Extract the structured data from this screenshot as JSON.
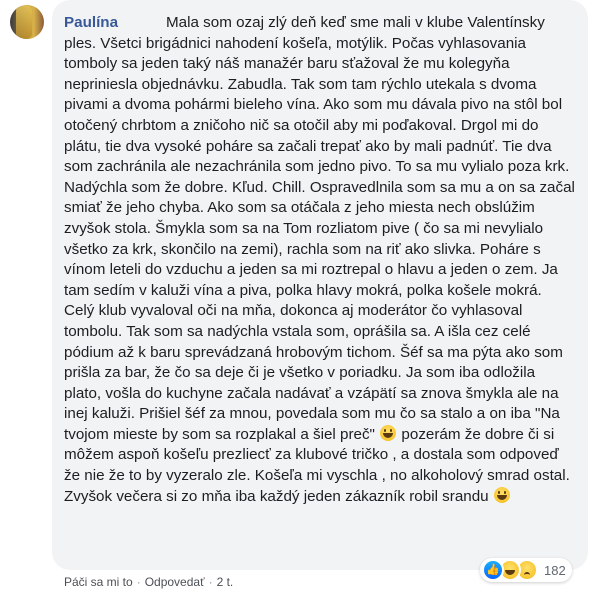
{
  "comment": {
    "author": "Paulína",
    "text_part1": "Mala som ozaj zlý deň keď sme mali v klube Valentínsky ples. Všetci brigádnici nahodení košeľa, motýlik. Počas vyhlasovania tomboly sa jeden taký náš manažér baru sťažoval že mu kolegyňa nepriniesla objednávku. Zabudla. Tak som tam rýchlo utekala s dvoma pivami a dvoma pohármi bieleho vína. Ako som mu dávala pivo na stôl bol otočený chrbtom a zničoho nič sa otočil aby mi poďakoval. Drgol mi do plátu, tie dva vysoké poháre sa začali trepať ako by mali padnúť. Tie dva som zachránila ale nezachránila som jedno pivo. To sa mu vylialo poza krk. Nadýchla som že dobre. Kľud. Chill. Ospravedlnila som sa mu a on sa začal smiať že jeho chyba. Ako som sa otáčala z jeho miesta nech obslúžim zvyšok stola. Šmykla som sa na Tom rozliatom pive ( čo sa mi nevylialo všetko za krk, skončilo na zemi), rachla som na riť ako slivka. Poháre s vínom leteli do vzduchu a jeden sa mi roztrepal o hlavu a jeden o zem. Ja tam sedím v kaluži vína a piva, polka hlavy mokrá, polka košele mokrá. Celý klub vyvaloval oči na mňa, dokonca aj moderátor čo vyhlasoval tombolu. Tak som sa nadýchla vstala som, oprášila sa. A išla cez celé pódium až k baru sprevádzaná hrobovým tichom. Šéf sa ma pýta ako som prišla za bar, že čo sa deje či je všetko v poriadku. Ja som iba odložila plato, vošla do kuchyne začala nadávať a vzápätí sa znova šmykla ale na inej kaluži. Prišiel šéf za mnou, povedala som mu čo sa stalo a on iba \"Na tvojom mieste by som sa rozplakal a šiel preč\"",
    "text_part2": "pozerám že dobre či si môžem aspoň košeľu prezliecť za klubové tričko , a dostala som odpoveď že nie že to by vyzeralo zle. Košeľa mi vyschla , no alkoholový smrad ostal. Zvyšok večera si zo mňa iba každý jeden zákazník robil srandu",
    "emoji_inline": "grinning-face-emoji"
  },
  "actions": {
    "like": "Páči sa mi to",
    "reply": "Odpovedať",
    "time": "2 t.",
    "separator": "·"
  },
  "reactions": {
    "icons": [
      "like-icon",
      "haha-icon",
      "sad-icon"
    ],
    "count": "182",
    "colors": {
      "like": "#1877f2",
      "emoji": "#f7c531"
    }
  },
  "colors": {
    "bubble": "#f2f3f5",
    "author": "#385898",
    "meta": "#606770"
  }
}
